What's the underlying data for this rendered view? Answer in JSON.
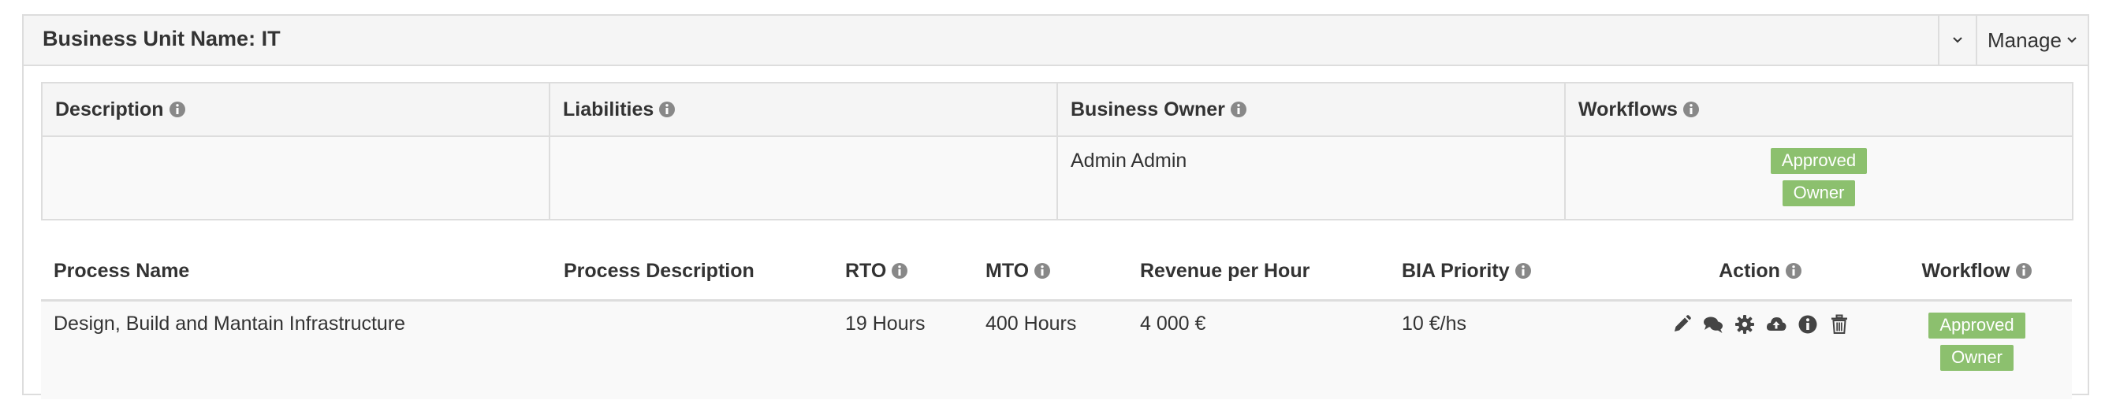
{
  "panel": {
    "title": "Business Unit Name: IT",
    "manage_label": "Manage"
  },
  "info_table": {
    "headers": [
      "Description",
      "Liabilities",
      "Business Owner",
      "Workflows"
    ],
    "row": {
      "description": "",
      "liabilities": "",
      "business_owner": "Admin Admin",
      "workflow_badges": [
        "Approved",
        "Owner"
      ]
    }
  },
  "process_table": {
    "headers": [
      "Process Name",
      "Process Description",
      "RTO",
      "MTO",
      "Revenue per Hour",
      "BIA Priority",
      "Action",
      "Workflow"
    ],
    "rows": [
      {
        "name": "Design, Build and Mantain Infrastructure",
        "description": "",
        "rto": "19 Hours",
        "mto": "400 Hours",
        "revenue": "4 000 €",
        "bia_priority": "10 €/hs",
        "actions": [
          "pencil-icon",
          "comments-icon",
          "gear-icon",
          "cloud-upload-icon",
          "info-icon",
          "trash-icon"
        ],
        "workflow_badges": [
          "Approved",
          "Owner"
        ]
      }
    ]
  },
  "colors": {
    "badge": "#8cc06e",
    "header_bg": "#f5f5f5",
    "border": "#dddddd"
  }
}
